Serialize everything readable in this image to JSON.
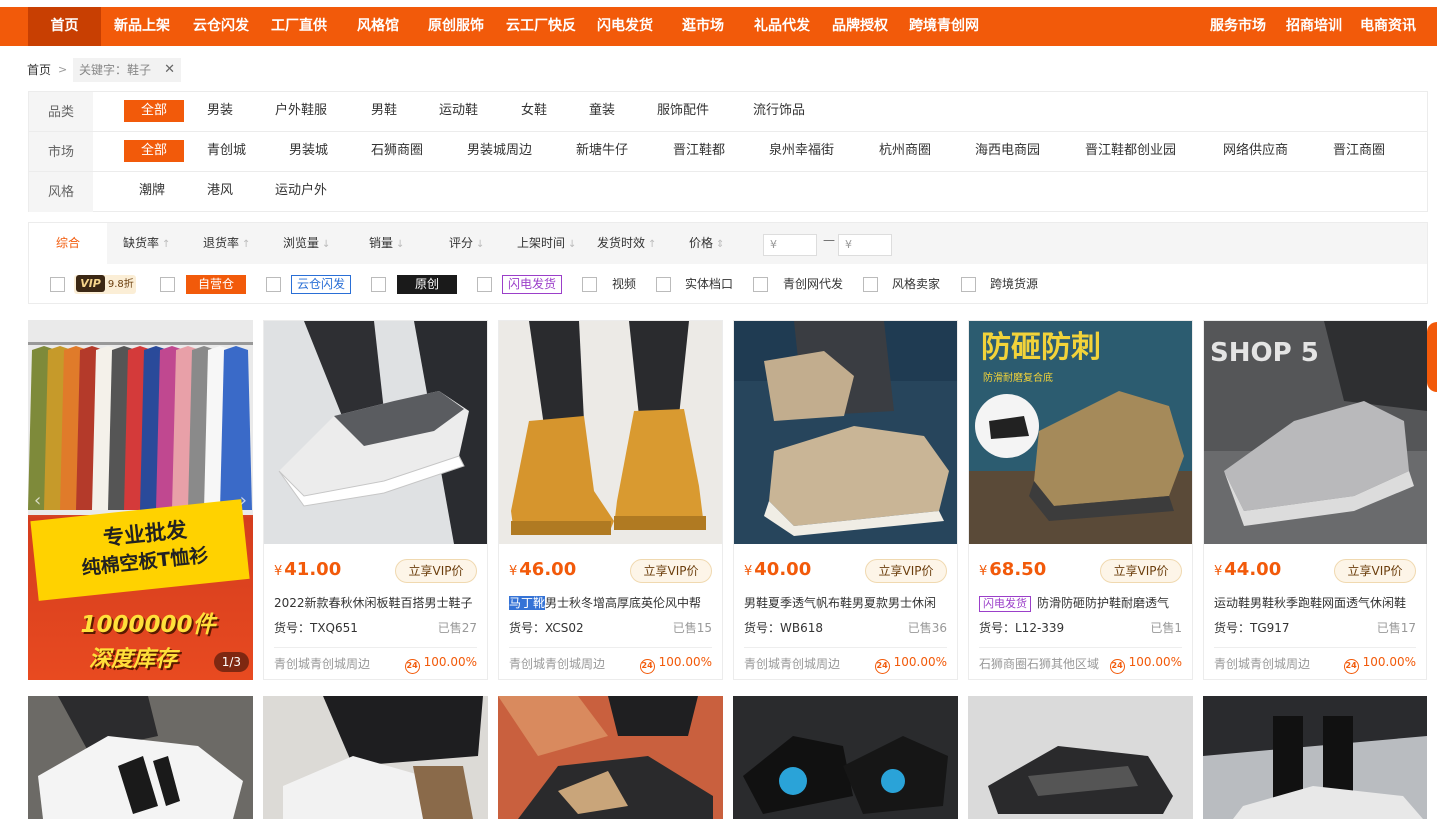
{
  "nav": {
    "items": [
      "首页",
      "新品上架",
      "云仓闪发",
      "工厂直供",
      "风格馆",
      "原创服饰",
      "云工厂快反",
      "闪电发货",
      "逛市场",
      "礼品代发",
      "品牌授权",
      "跨境青创网"
    ],
    "right": [
      "服务市场",
      "招商培训",
      "电商资讯"
    ]
  },
  "breadcrumb": {
    "home": "首页",
    "sep": ">",
    "keyword": "关键字：鞋子",
    "close": "✕"
  },
  "filters": {
    "category": {
      "label": "品类",
      "options": [
        "全部",
        "男装",
        "户外鞋服",
        "男鞋",
        "运动鞋",
        "女鞋",
        "童装",
        "服饰配件",
        "流行饰品"
      ]
    },
    "market": {
      "label": "市场",
      "options": [
        "全部",
        "青创城",
        "男装城",
        "石狮商圈",
        "男装城周边",
        "新塘牛仔",
        "晋江鞋都",
        "泉州幸福街",
        "杭州商圈",
        "海西电商园",
        "晋江鞋都创业园",
        "网络供应商",
        "晋江商圈"
      ]
    },
    "style": {
      "label": "风格",
      "options": [
        "潮牌",
        "港风",
        "运动户外"
      ]
    }
  },
  "sort": {
    "items": [
      "综合",
      "缺货率",
      "退货率",
      "浏览量",
      "销量",
      "评分",
      "上架时间",
      "发货时效",
      "价格"
    ],
    "arrows": [
      "↑",
      "↑",
      "↓",
      "↓",
      "↓",
      "↓",
      "↑",
      "⇕"
    ],
    "price_min": "¥",
    "price_max": "¥",
    "dash": "—"
  },
  "tags": {
    "vip": "VIP",
    "vip_discount": "9.8折",
    "self": "自营仓",
    "cloud": "云仓闪发",
    "original": "原创",
    "flash": "闪电发货",
    "video": "视频",
    "store": "实体档口",
    "agent": "青创网代发",
    "seller": "风格卖家",
    "cross": "跨境货源"
  },
  "banner": {
    "line1": "专业批发",
    "line2": "纯棉空板T恤衫",
    "line3": "1000000件",
    "line4": "深度库存",
    "page": "1/3",
    "prev": "‹",
    "next": "›"
  },
  "products": [
    {
      "currency": "¥",
      "price": "41.00",
      "vip": "立享VIP价",
      "title_hl": "",
      "flash": "",
      "title": "2022新款春秋休闲板鞋百搭男士鞋子",
      "code": "货号：TXQ651",
      "sold": "已售27",
      "market": "青创城青创城周边",
      "badge": "24",
      "rate": "100.00%"
    },
    {
      "currency": "¥",
      "price": "46.00",
      "vip": "立享VIP价",
      "title_hl": "马丁靴",
      "flash": "",
      "title": "男士秋冬增高厚底英伦风中帮",
      "code": "货号：XCS02",
      "sold": "已售15",
      "market": "青创城青创城周边",
      "badge": "24",
      "rate": "100.00%"
    },
    {
      "currency": "¥",
      "price": "40.00",
      "vip": "立享VIP价",
      "title_hl": "",
      "flash": "",
      "title": "男鞋夏季透气帆布鞋男夏款男士休闲",
      "code": "货号：WB618",
      "sold": "已售36",
      "market": "青创城青创城周边",
      "badge": "24",
      "rate": "100.00%"
    },
    {
      "currency": "¥",
      "price": "68.50",
      "vip": "立享VIP价",
      "title_hl": "",
      "flash": "闪电发货",
      "title": "防滑防砸防护鞋耐磨透气",
      "code": "货号：L12-339",
      "sold": "已售1",
      "market": "石狮商圈石狮其他区域",
      "badge": "24",
      "rate": "100.00%"
    },
    {
      "currency": "¥",
      "price": "44.00",
      "vip": "立享VIP价",
      "title_hl": "",
      "flash": "",
      "title": "运动鞋男鞋秋季跑鞋网面透气休闲鞋",
      "code": "货号：TG917",
      "sold": "已售17",
      "market": "青创城青创城周边",
      "badge": "24",
      "rate": "100.00%"
    }
  ],
  "product_images": {
    "p4_headline": "防砸防刺",
    "p4_sub": "防滑耐磨复合底",
    "p5_wall": "SHOP 5"
  },
  "colors": {
    "brand": "#f25a0a",
    "nav_active": "#c83f02",
    "flash": "#9b3fc9",
    "cloud": "#2a6fd6"
  }
}
